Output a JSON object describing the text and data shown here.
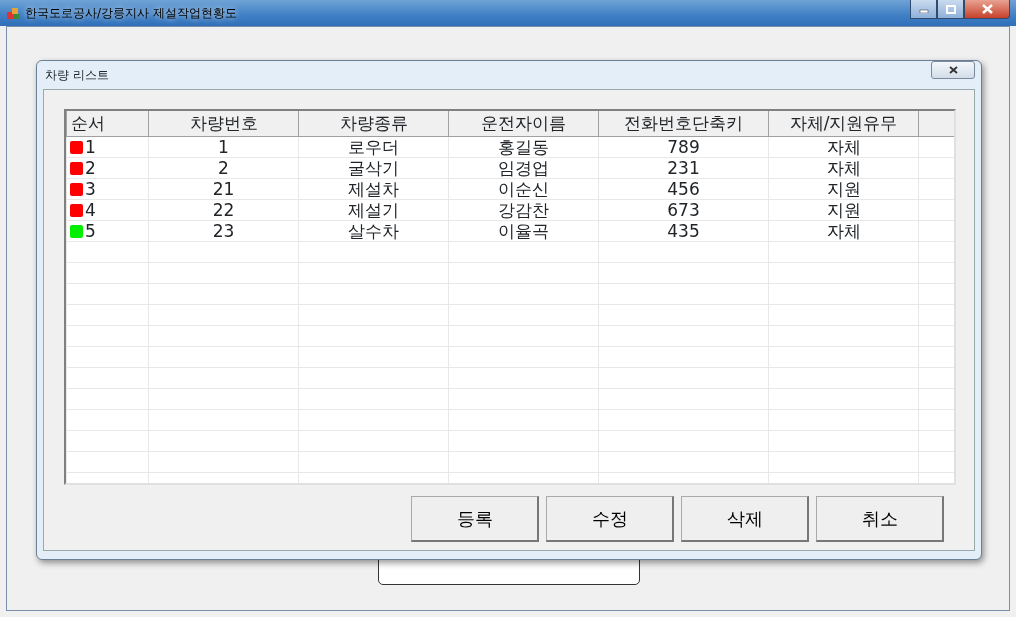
{
  "window": {
    "title": "한국도로공사/강릉지사 제설작업현황도"
  },
  "dialog": {
    "title": "차량 리스트"
  },
  "table": {
    "columns": [
      "순서",
      "차량번호",
      "차량종류",
      "운전자이름",
      "전화번호단축키",
      "자체/지원유무"
    ],
    "rows": [
      {
        "color": "#ff0000",
        "cells": [
          "1",
          "1",
          "로우더",
          "홍길동",
          "789",
          "자체"
        ]
      },
      {
        "color": "#ff0000",
        "cells": [
          "2",
          "2",
          "굴삭기",
          "임경업",
          "231",
          "자체"
        ]
      },
      {
        "color": "#ff0000",
        "cells": [
          "3",
          "21",
          "제설차",
          "이순신",
          "456",
          "지원"
        ]
      },
      {
        "color": "#ff0000",
        "cells": [
          "4",
          "22",
          "제설기",
          "강감찬",
          "673",
          "지원"
        ]
      },
      {
        "color": "#00ee00",
        "cells": [
          "5",
          "23",
          "살수차",
          "이율곡",
          "435",
          "자체"
        ]
      }
    ]
  },
  "buttons": [
    "등록",
    "수정",
    "삭제",
    "취소"
  ]
}
